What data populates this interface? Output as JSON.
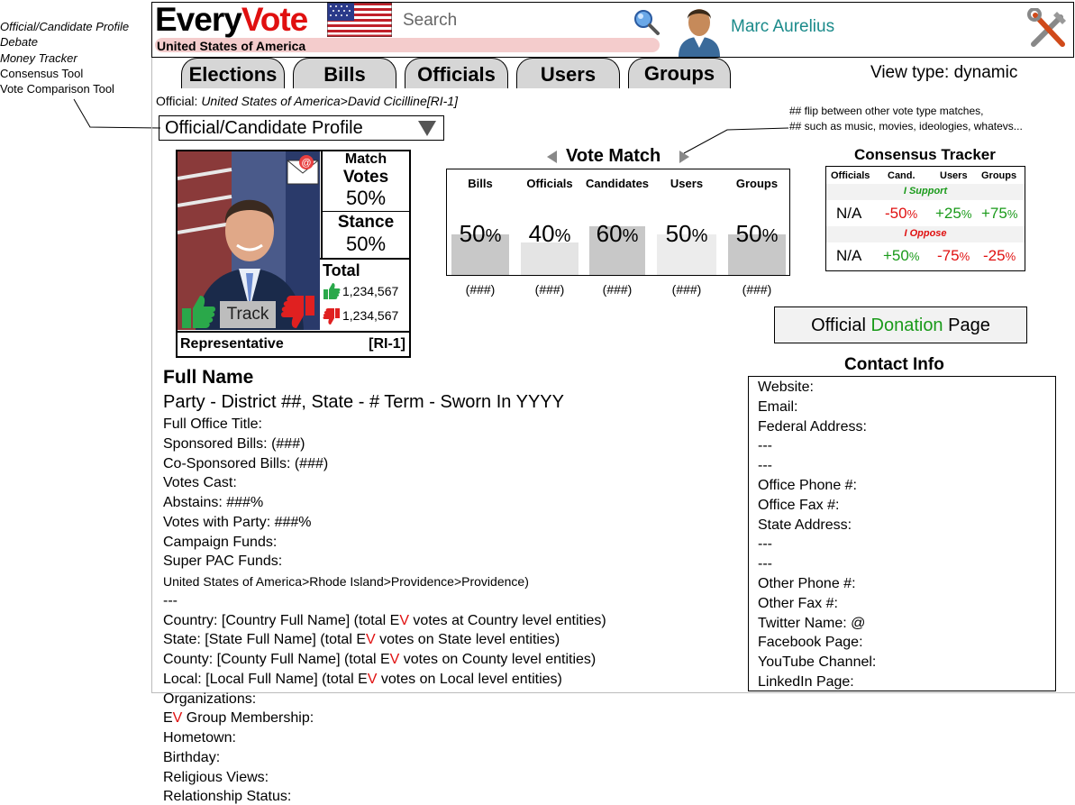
{
  "side_notes": [
    {
      "label": "Official/Candidate Profile",
      "italic": true
    },
    {
      "label": "Debate",
      "italic": true
    },
    {
      "label": "Money Tracker",
      "italic": true
    },
    {
      "label": "Consensus Tool",
      "italic": false
    },
    {
      "label": "Vote Comparison Tool",
      "italic": false
    }
  ],
  "header": {
    "logo_every": "Every",
    "logo_vote": "Vote",
    "country": "United States of America",
    "search_placeholder": "Search",
    "user_name": "Marc Aurelius"
  },
  "tabs": [
    "Elections",
    "Bills",
    "Officials",
    "Users",
    "Groups"
  ],
  "view_type": "View type: dynamic",
  "breadcrumb": {
    "prefix": "Official: ",
    "path": "United States of America>David Cicilline[RI-1]"
  },
  "profile_dropdown": "Official/Candidate Profile",
  "card": {
    "match_label": "Match",
    "votes_label": "Votes",
    "votes_value": "50%",
    "stance_label": "Stance",
    "stance_value": "50%",
    "total_label": "Total",
    "up_count": "1,234,567",
    "down_count": "1,234,567",
    "track_label": "Track",
    "role": "Representative",
    "district": "[RI-1]"
  },
  "vote_match": {
    "title": "Vote Match",
    "columns": [
      {
        "header": "Bills",
        "value": "50",
        "count": "(###)",
        "fill": 0.5
      },
      {
        "header": "Officials",
        "value": "40",
        "count": "(###)",
        "fill": 0.4
      },
      {
        "header": "Candidates",
        "value": "60",
        "count": "(###)",
        "fill": 0.6
      },
      {
        "header": "Users",
        "value": "50",
        "count": "(###)",
        "fill": 0.5
      },
      {
        "header": "Groups",
        "value": "50",
        "count": "(###)",
        "fill": 0.5
      }
    ],
    "pct_symbol": "%"
  },
  "flip_note": [
    "## flip between other vote type matches,",
    "## such as music, movies, ideologies, whatevs..."
  ],
  "consensus": {
    "title": "Consensus Tracker",
    "headers": [
      "Officials",
      "Cand.",
      "Users",
      "Groups"
    ],
    "support_label": "I Support",
    "oppose_label": "I Oppose",
    "support": {
      "officials": "N/A",
      "cand": "-50",
      "users": "+25",
      "groups": "+75"
    },
    "oppose": {
      "officials": "N/A",
      "cand": "+50",
      "users": "-75",
      "groups": "-25"
    }
  },
  "donation": {
    "pre": "Official ",
    "highlight": "Donation",
    "post": " Page",
    "highlight_color": "#1a9a1a"
  },
  "contact": {
    "title": "Contact Info",
    "lines": [
      "Website:",
      "Email:",
      "Federal Address:",
      "---",
      "---",
      "Office Phone #:",
      "Office Fax #:",
      "State Address:",
      "---",
      "---",
      "Other Phone #:",
      "Other Fax #:",
      "Twitter Name: @",
      "Facebook Page:",
      "YouTube Channel:",
      "LinkedIn Page:"
    ]
  },
  "details": {
    "full_name": "Full Name",
    "party_line": "Party - District ##, State - # Term - Sworn In YYYY",
    "lines_a": [
      "Full Office Title:",
      "Sponsored Bills: (###)",
      "Co-Sponsored Bills: (###)",
      "Votes Cast:",
      "Abstains: ###%",
      "Votes with Party: ###%",
      "Campaign Funds:",
      "Super PAC Funds:"
    ],
    "location_path": "United States of America>Rhode Island>Providence>Providence)",
    "separator": "---",
    "levels": [
      {
        "pre": "Country: [Country Full Name] (total E",
        "post": " votes at Country level entities)"
      },
      {
        "pre": "State: [State Full Name] (total E",
        "post": " votes on State level entities)"
      },
      {
        "pre": "County: [County Full Name] (total E",
        "post": " votes on County level entities)"
      },
      {
        "pre": "Local: [Local Full Name] (total E",
        "post": " votes on Local level entities)"
      }
    ],
    "ev_v": "V",
    "organizations": "Organizations:",
    "group_membership_pre": "E",
    "group_membership_post": " Group Membership:",
    "lines_b": [
      "Hometown:",
      "Birthday:",
      "Religious Views:",
      "Relationship Status:"
    ]
  },
  "colors": {
    "accent_red": "#e01010",
    "teal": "#1a8a8a",
    "green": "#1a9a1a",
    "tab_gray": "#d6d6d6"
  }
}
